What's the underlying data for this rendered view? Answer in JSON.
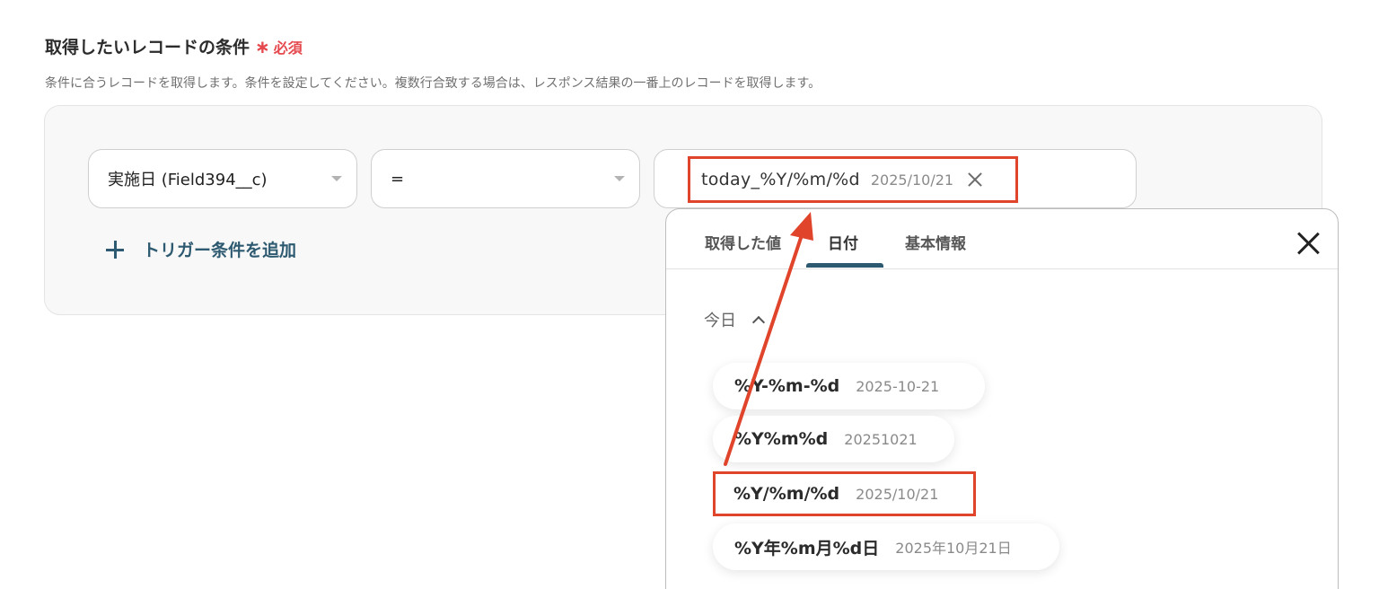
{
  "section": {
    "title": "取得したいレコードの条件",
    "required_mark": "∗",
    "required_text": "必須",
    "description": "条件に合うレコードを取得します。条件を設定してください。複数行合致する場合は、レスポンス結果の一番上のレコードを取得します。"
  },
  "condition": {
    "field_value": "実施日 (Field394__c)",
    "operator_value": "=",
    "value_chip": {
      "variable": "today_%Y/%m/%d",
      "preview": "2025/10/21"
    },
    "add_label": "トリガー条件を追加"
  },
  "popup": {
    "tabs": [
      {
        "label": "取得した値"
      },
      {
        "label": "日付",
        "active": true
      },
      {
        "label": "基本情報"
      }
    ],
    "group": {
      "label": "今日",
      "expanded": true
    },
    "options": [
      {
        "variable": "%Y-%m-%d",
        "preview": "2025-10-21"
      },
      {
        "variable": "%Y%m%d",
        "preview": "20251021"
      },
      {
        "variable": "%Y/%m/%d",
        "preview": "2025/10/21",
        "highlighted": true
      },
      {
        "variable": "%Y年%m月%d日",
        "preview": "2025年10月21日"
      }
    ]
  },
  "colors": {
    "accent": "#2d5a70",
    "highlight": "#e0452b",
    "required": "#e5484d"
  }
}
